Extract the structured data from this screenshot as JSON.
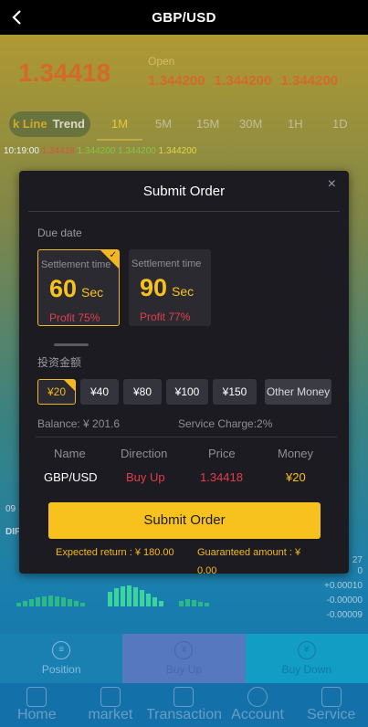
{
  "header": {
    "back_label": "<",
    "title": "GBP/USD"
  },
  "quote": {
    "price": "1.34418",
    "open_label": "Open",
    "open_values": "1.344200 1.344200 1.344200"
  },
  "chart_tabs": {
    "kline_label": "k Line",
    "trend_label": "Trend",
    "timeframes": [
      "1M",
      "5M",
      "15M",
      "30M",
      "1H",
      "1D"
    ]
  },
  "ticker": {
    "time": "10:19:00",
    "v1": "1.34418",
    "v2": "1.344200",
    "v3": "1.344200",
    "v4": "1.344200"
  },
  "chart_side": {
    "left_time": "09",
    "left_dif": "DIF",
    "right_values": [
      "27",
      "0",
      "+0.00010",
      "-0.00000",
      "-0.00009"
    ]
  },
  "actions": {
    "position": "Position",
    "buy_up": "Buy Up",
    "buy_down": "Buy Down"
  },
  "nav": [
    "Home",
    "market",
    "Transaction",
    "Account",
    "Service"
  ],
  "modal": {
    "close": "×",
    "title": "Submit Order",
    "due_label": "Due date",
    "options": [
      {
        "settlement": "Settlement time",
        "seconds": "60",
        "unit": "Sec",
        "profit": "Profit 75%"
      },
      {
        "settlement": "Settlement time",
        "seconds": "90",
        "unit": "Sec",
        "profit": "Profit 77%"
      }
    ],
    "amount_label": "投资金额",
    "amounts": [
      "¥20",
      "¥40",
      "¥80",
      "¥100",
      "¥150"
    ],
    "other_money": "Other Money",
    "balance": "Balance: ¥ 201.6",
    "service_charge": "Service Charge:2%",
    "table_headers": [
      "Name",
      "Direction",
      "Price",
      "Money"
    ],
    "table_row": {
      "name": "GBP/USD",
      "direction": "Buy Up",
      "price": "1.34418",
      "money": "¥20"
    },
    "submit_label": "Submit Order",
    "expected_return": "Expected return : ¥ 180.00",
    "guaranteed_amount": "Guaranteed amount : ¥",
    "guaranteed_value": "0.00"
  },
  "colors": {
    "accent": "#f7c21e",
    "profit_red": "#e33d4a",
    "modal_bg": "#1c1b21"
  }
}
